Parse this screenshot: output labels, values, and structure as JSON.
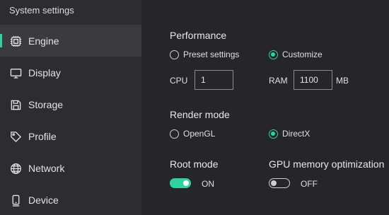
{
  "app": {
    "title": "System settings"
  },
  "sidebar": {
    "items": [
      {
        "label": "Engine",
        "icon": "chip-icon",
        "active": true
      },
      {
        "label": "Display",
        "icon": "monitor-icon",
        "active": false
      },
      {
        "label": "Storage",
        "icon": "save-icon",
        "active": false
      },
      {
        "label": "Profile",
        "icon": "tag-icon",
        "active": false
      },
      {
        "label": "Network",
        "icon": "globe-icon",
        "active": false
      },
      {
        "label": "Device",
        "icon": "phone-icon",
        "active": false
      }
    ]
  },
  "performance": {
    "heading": "Performance",
    "options": [
      {
        "label": "Preset settings",
        "selected": false
      },
      {
        "label": "Customize",
        "selected": true
      }
    ],
    "cpu": {
      "label": "CPU",
      "value": "1"
    },
    "ram": {
      "label": "RAM",
      "value": "1100",
      "unit": "MB"
    }
  },
  "render_mode": {
    "heading": "Render mode",
    "options": [
      {
        "label": "OpenGL",
        "selected": false
      },
      {
        "label": "DirectX",
        "selected": true
      }
    ]
  },
  "root_mode": {
    "heading": "Root mode",
    "state": "ON",
    "enabled": true
  },
  "gpu_optimization": {
    "heading": "GPU memory optimization",
    "state": "OFF",
    "enabled": false
  },
  "colors": {
    "accent": "#2ed39e",
    "sidebar_bg": "#2d2d31",
    "main_bg": "#26262a",
    "active_bg": "#3a3a3f"
  }
}
